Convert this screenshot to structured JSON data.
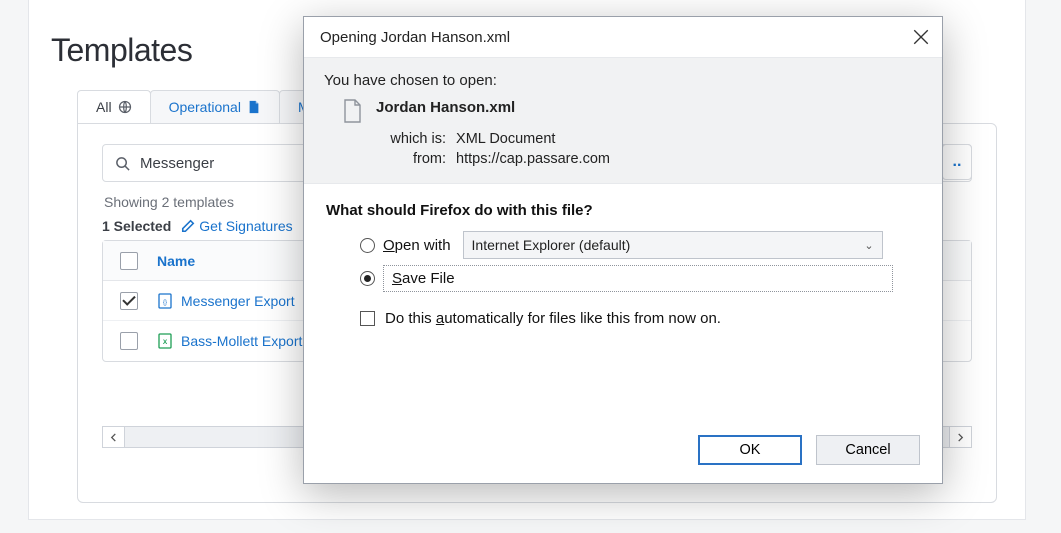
{
  "page": {
    "title": "Templates",
    "tabs": [
      {
        "label": "All",
        "active": true
      },
      {
        "label": "Operational",
        "active": false
      },
      {
        "label": "M",
        "active": false
      }
    ],
    "ellipsis_button": "..",
    "search": {
      "value": "Messenger",
      "placeholder": ""
    },
    "showing_text": "Showing 2 templates",
    "selected_count_text": "1 Selected",
    "get_signatures_label": "Get Signatures",
    "table": {
      "header": {
        "name": "Name"
      },
      "rows": [
        {
          "checked": true,
          "icon": "xml",
          "name": "Messenger Export"
        },
        {
          "checked": false,
          "icon": "xls",
          "name": "Bass-Mollett Export"
        }
      ]
    }
  },
  "dialog": {
    "title": "Opening Jordan Hanson.xml",
    "chosen_text": "You have chosen to open:",
    "file_name": "Jordan Hanson.xml",
    "which_is_label": "which is:",
    "which_is_value": "XML Document",
    "from_label": "from:",
    "from_value": "https://cap.passare.com",
    "question": "What should Firefox do with this file?",
    "open_with_label": "Open with",
    "open_with_value": "Internet Explorer (default)",
    "save_file_label": "Save File",
    "auto_label_pre": "Do this ",
    "auto_label_u": "a",
    "auto_label_post": "utomatically for files like this from now on.",
    "ok_label": "OK",
    "cancel_label": "Cancel",
    "selected_option": "save"
  }
}
